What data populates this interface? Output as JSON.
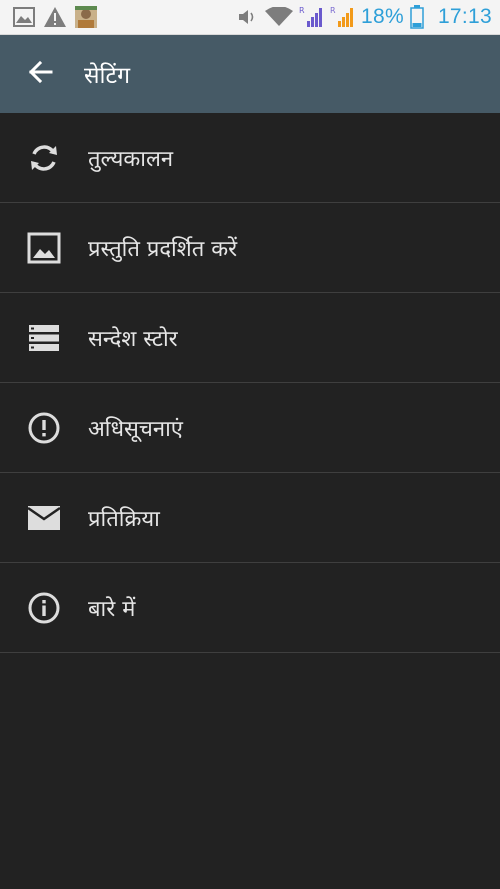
{
  "status_bar": {
    "icons_left": [
      "image-notification-icon",
      "warning-notification-icon",
      "contact-photo-notification-icon"
    ],
    "icons_right": [
      "volume-icon",
      "wifi-icon",
      "signal-r-icon",
      "signal-r-orange-icon",
      "battery-icon"
    ],
    "battery": "18%",
    "time": "17:13",
    "accent_color": "#2e9fd8"
  },
  "app_bar": {
    "title": "सेटिंग",
    "back_icon": "arrow-back-icon",
    "background": "#465a66"
  },
  "menu": {
    "items": [
      {
        "icon": "sync-icon",
        "label": "तुल्यकालन"
      },
      {
        "icon": "image-icon",
        "label": "प्रस्तुति प्रदर्शित करें"
      },
      {
        "icon": "storage-icon",
        "label": "सन्देश स्टोर"
      },
      {
        "icon": "alert-circle-icon",
        "label": "अधिसूचनाएं"
      },
      {
        "icon": "mail-icon",
        "label": "प्रतिक्रिया"
      },
      {
        "icon": "info-icon",
        "label": "बारे में"
      }
    ]
  }
}
